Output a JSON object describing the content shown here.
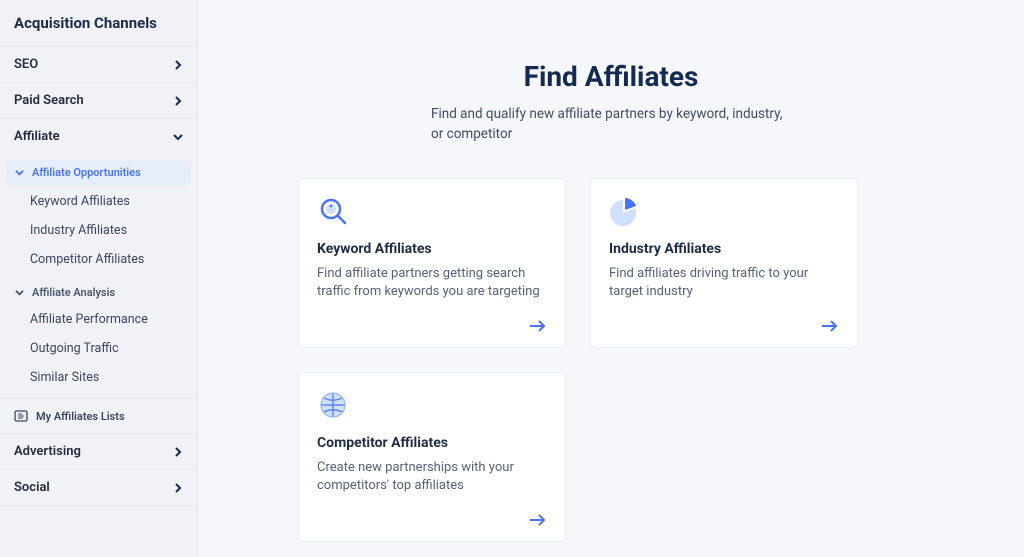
{
  "sidebar": {
    "title": "Acquisition Channels",
    "items": [
      {
        "label": "SEO",
        "open": false
      },
      {
        "label": "Paid Search",
        "open": false
      },
      {
        "label": "Affiliate",
        "open": true
      },
      {
        "label": "Advertising",
        "open": false
      },
      {
        "label": "Social",
        "open": false
      }
    ],
    "affiliate": {
      "groups": [
        {
          "label": "Affiliate Opportunities",
          "active": true,
          "links": [
            {
              "label": "Keyword Affiliates"
            },
            {
              "label": "Industry Affiliates"
            },
            {
              "label": "Competitor Affiliates"
            }
          ]
        },
        {
          "label": "Affiliate Analysis",
          "active": false,
          "links": [
            {
              "label": "Affiliate Performance"
            },
            {
              "label": "Outgoing Traffic"
            },
            {
              "label": "Similar Sites"
            }
          ]
        }
      ],
      "myLists": "My Affiliates Lists"
    }
  },
  "page": {
    "title": "Find Affiliates",
    "subtitle": "Find and qualify new affiliate partners by keyword, industry, or competitor"
  },
  "cards": [
    {
      "title": "Keyword Affiliates",
      "desc": "Find affiliate partners getting search traffic from keywords you are targeting",
      "icon": "magnify"
    },
    {
      "title": "Industry Affiliates",
      "desc": "Find affiliates driving traffic to your target industry",
      "icon": "pie"
    },
    {
      "title": "Competitor Affiliates",
      "desc": "Create new partnerships with your competitors' top affiliates",
      "icon": "globe"
    }
  ]
}
